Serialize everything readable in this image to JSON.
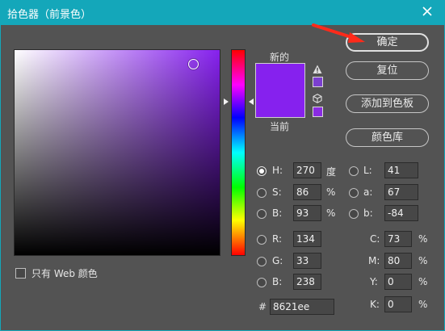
{
  "window": {
    "title": "拾色器（前景色）"
  },
  "icons": {
    "close": "close-icon",
    "warning": "warning-icon",
    "cube": "cube-icon"
  },
  "colors": {
    "current": "#8621ee",
    "accent": "#14a7ba"
  },
  "preview": {
    "new_label": "新的",
    "current_label": "当前"
  },
  "buttons": {
    "ok": "确定",
    "reset": "复位",
    "add_to_swatches": "添加到色板",
    "color_libraries": "颜色库"
  },
  "hsb": {
    "h": {
      "label": "H:",
      "value": "270",
      "unit": "度"
    },
    "s": {
      "label": "S:",
      "value": "86",
      "unit": "%"
    },
    "b": {
      "label": "B:",
      "value": "93",
      "unit": "%"
    }
  },
  "lab": {
    "l": {
      "label": "L:",
      "value": "41"
    },
    "a": {
      "label": "a:",
      "value": "67"
    },
    "b": {
      "label": "b:",
      "value": "-84"
    }
  },
  "rgb": {
    "r": {
      "label": "R:",
      "value": "134"
    },
    "g": {
      "label": "G:",
      "value": "33"
    },
    "b": {
      "label": "B:",
      "value": "238"
    }
  },
  "cmyk": {
    "c": {
      "label": "C:",
      "value": "73",
      "unit": "%"
    },
    "m": {
      "label": "M:",
      "value": "80",
      "unit": "%"
    },
    "y": {
      "label": "Y:",
      "value": "0",
      "unit": "%"
    },
    "k": {
      "label": "K:",
      "value": "0",
      "unit": "%"
    }
  },
  "hex": {
    "label": "#",
    "value": "8621ee"
  },
  "web_only": {
    "label": "只有 Web 颜色"
  }
}
